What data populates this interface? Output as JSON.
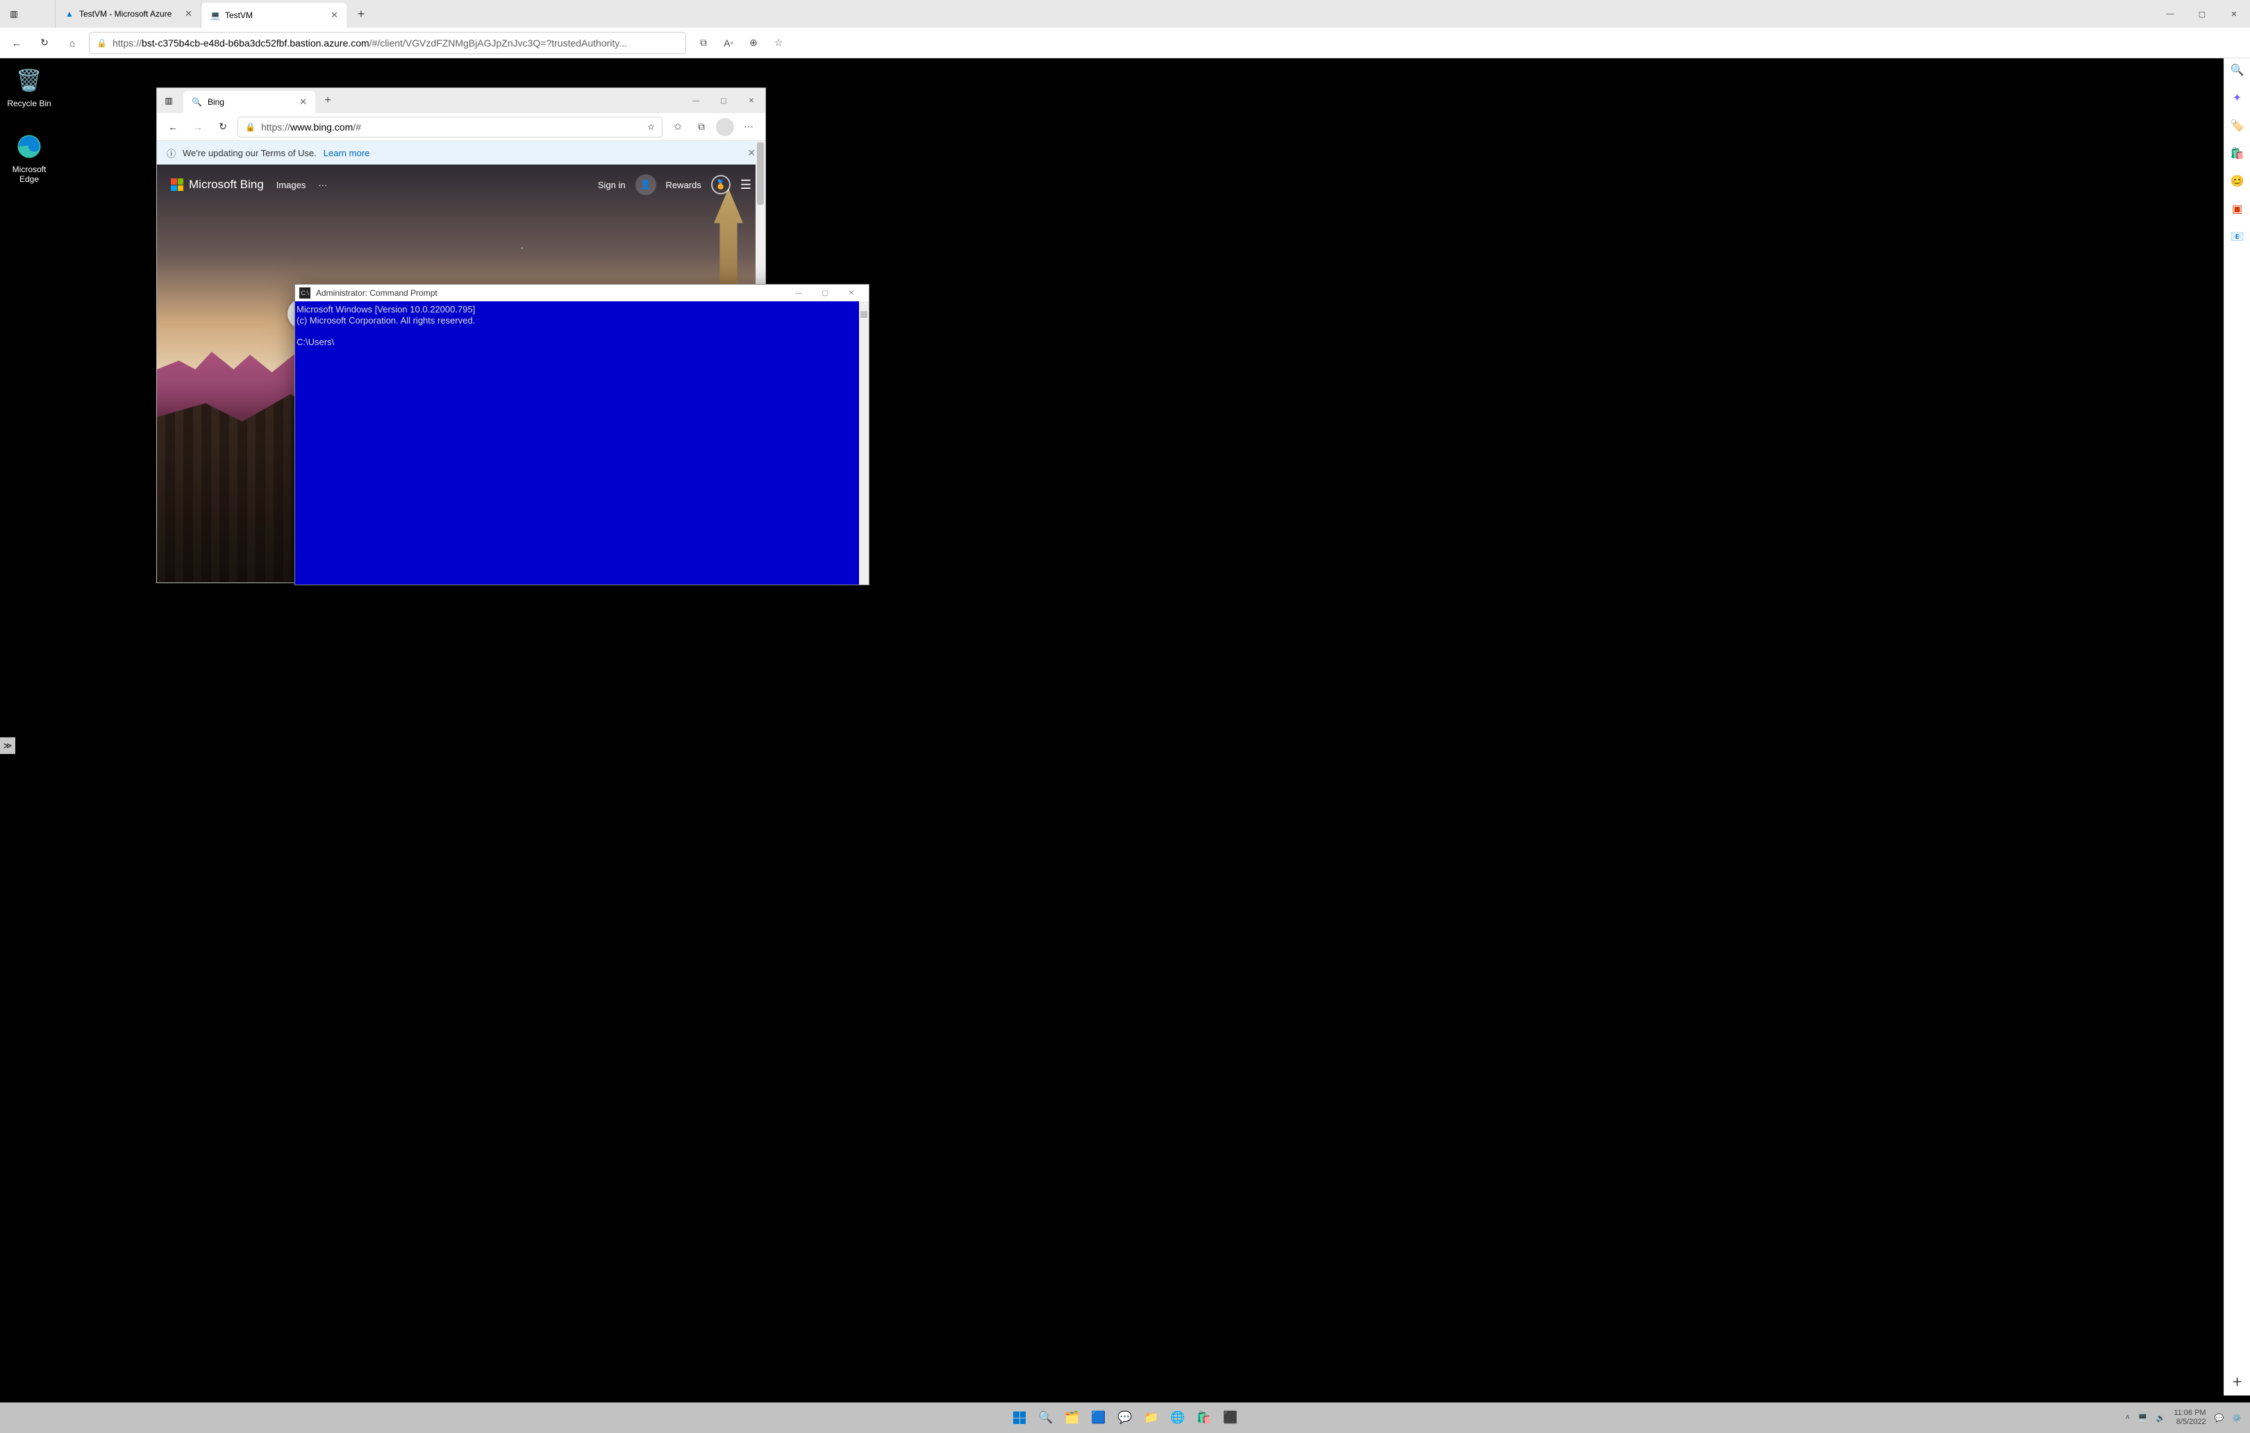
{
  "outer_edge": {
    "tabs": [
      {
        "title": "TestVM  - Microsoft Azure",
        "favicon": "azure",
        "active": false
      },
      {
        "title": "TestVM",
        "favicon": "edge",
        "active": true
      }
    ],
    "url_host": "bst-c375b4cb-e48d-b6ba3dc52fbf.bastion.azure.com",
    "url_rest": "/#/client/VGVzdFZNMgBjAGJpZnJvc3Q=?trustedAuthority...",
    "sidebar_icons": [
      "search",
      "sparkle",
      "tag",
      "shopping",
      "emoji",
      "office",
      "outlook",
      "plus"
    ]
  },
  "desktop": {
    "icons": [
      {
        "name": "Recycle Bin",
        "glyph": "🗑️"
      },
      {
        "name": "Microsoft Edge",
        "glyph": "🌐"
      }
    ]
  },
  "inner_edge": {
    "tab_title": "Bing",
    "url_host": "www.bing.com",
    "url_rest": "/#",
    "notice_text": "We're updating our Terms of Use.",
    "notice_link": "Learn more",
    "logo_text": "Microsoft Bing",
    "menu": {
      "images": "Images",
      "more": "···"
    },
    "signin": "Sign in",
    "rewards": "Rewards",
    "search_placeholder": ""
  },
  "cmd": {
    "title": "Administrator: Command Prompt",
    "line1": "Microsoft Windows [Version 10.0.22000.795]",
    "line2": "(c) Microsoft Corporation. All rights reserved.",
    "prompt": "C:\\Users\\"
  },
  "taskbar": {
    "time": "11:06 PM",
    "date": "8/5/2022"
  }
}
